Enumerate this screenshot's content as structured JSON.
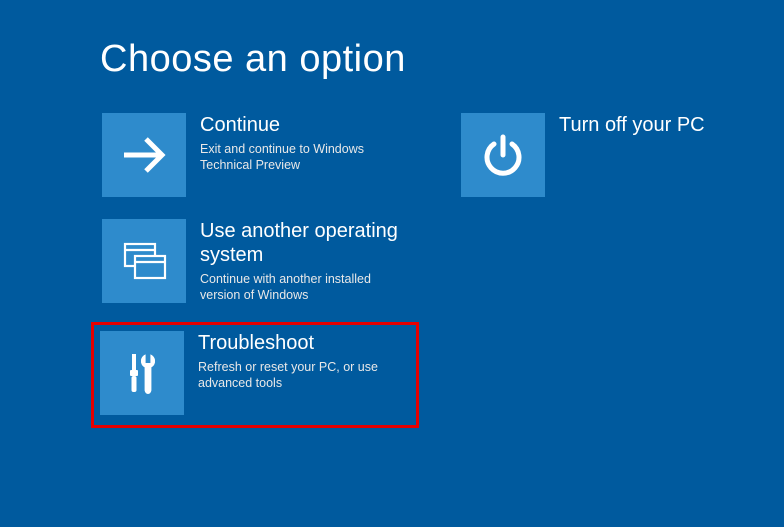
{
  "page_title": "Choose an option",
  "options": {
    "continue": {
      "title": "Continue",
      "desc": "Exit and continue to Windows Technical Preview"
    },
    "use_another_os": {
      "title": "Use another operating system",
      "desc": "Continue with another installed version of Windows"
    },
    "troubleshoot": {
      "title": "Troubleshoot",
      "desc": "Refresh or reset your PC, or use advanced tools"
    },
    "turn_off": {
      "title": "Turn off your PC"
    }
  },
  "colors": {
    "background": "#005a9e",
    "tile": "#2e8bcc",
    "highlight": "#e60000"
  }
}
